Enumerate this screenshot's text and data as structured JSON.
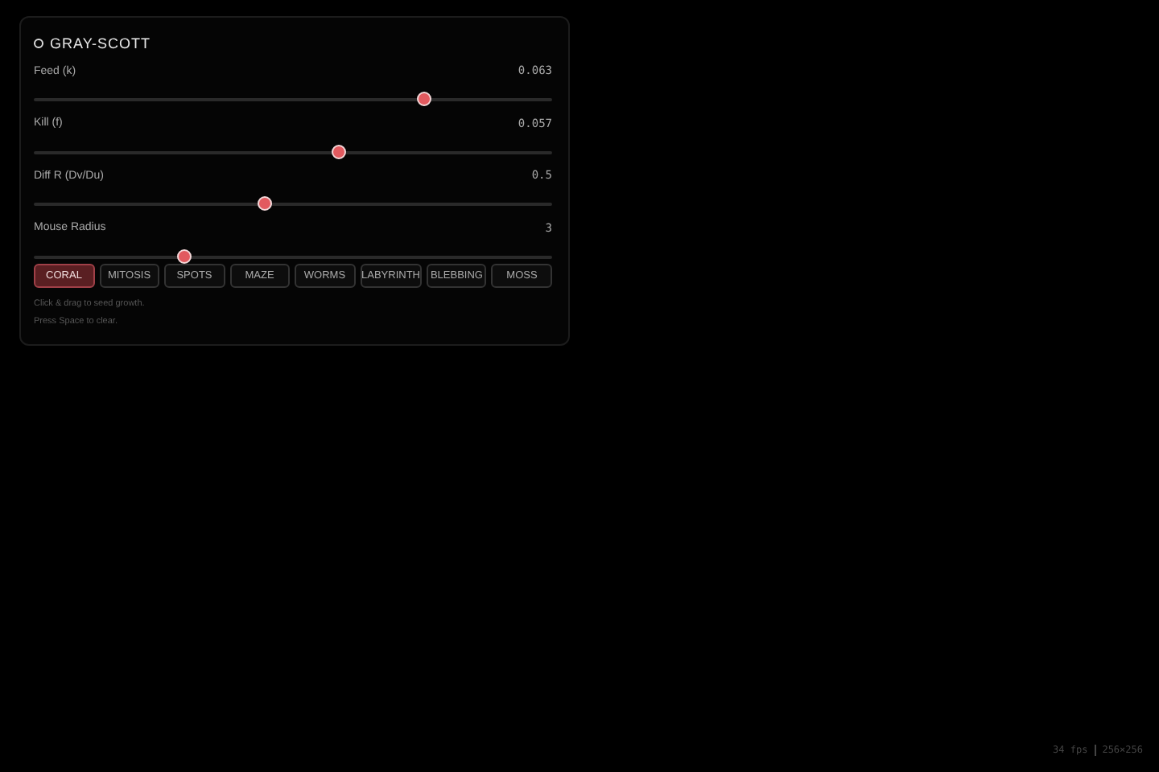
{
  "panel": {
    "title": "GRAY-SCOTT",
    "sliders": [
      {
        "label": "Feed (k)",
        "reading": "0.063",
        "level": 0.75
      },
      {
        "label": "Kill (f)",
        "reading": "0.057",
        "level": 0.586
      },
      {
        "label": "Diff R (Dv/Du)",
        "reading": "0.5",
        "level": 0.444
      },
      {
        "label": "Mouse Radius",
        "reading": "3",
        "level": 0.29
      }
    ],
    "presets": [
      {
        "label": "CORAL",
        "selected": true
      },
      {
        "label": "MITOSIS",
        "selected": false
      },
      {
        "label": "SPOTS",
        "selected": false
      },
      {
        "label": "MAZE",
        "selected": false
      },
      {
        "label": "WORMS",
        "selected": false
      },
      {
        "label": "LABYRINTH",
        "selected": false
      },
      {
        "label": "BLEBBING",
        "selected": false
      },
      {
        "label": "MOSS",
        "selected": false
      }
    ],
    "hints": [
      "Click & drag to seed growth.",
      "Press Space to clear."
    ]
  },
  "status": {
    "fps": "34 fps",
    "size": "256×256"
  }
}
